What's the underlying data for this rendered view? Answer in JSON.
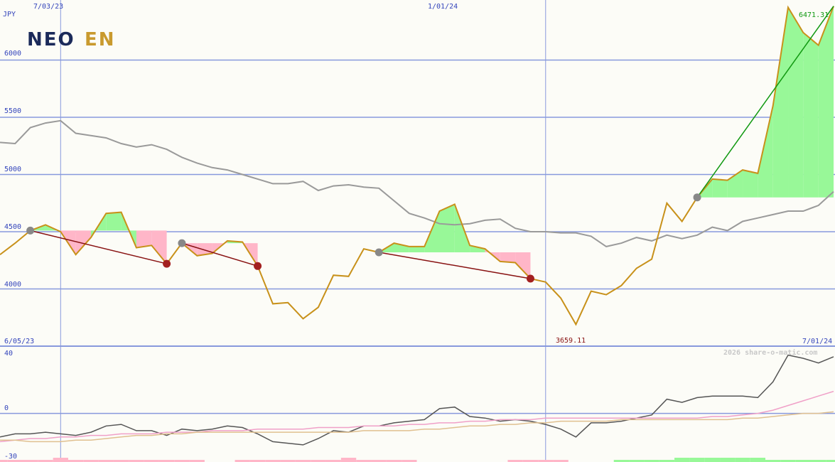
{
  "chart_data": [
    {
      "type": "line",
      "currency": "JPY",
      "logo": {
        "part_a": "NEO",
        "part_b": "EN"
      },
      "y_ticks": [
        "6000",
        "5500",
        "5000",
        "4500",
        "4000"
      ],
      "ylim": [
        3500,
        6500
      ],
      "date_labels": [
        "7/03/23",
        "1/01/24"
      ],
      "start_label": "6/05/23",
      "end_label": "7/01/24",
      "max_label": "6471.31",
      "min_label": "3659.11",
      "credit": "2026 share-o-matic.com",
      "colors": {
        "price": "#c8911a",
        "ma": "#999999",
        "gain": "#98f898",
        "loss": "#ffb6c8",
        "up_trend": "#119911",
        "down_trend": "#881111",
        "grid": "#8899dd"
      },
      "series": [
        {
          "values": [
            4300,
            4400,
            4510,
            4560,
            4500,
            4300,
            4450,
            4660,
            4670,
            4360,
            4380,
            4220,
            4400,
            4290,
            4310,
            4420,
            4410,
            4200,
            3870,
            3880,
            3740,
            3840,
            4120,
            4110,
            4350,
            4320,
            4400,
            4370,
            4370,
            4680,
            4740,
            4380,
            4350,
            4240,
            4230,
            4090,
            4060,
            3920,
            3690,
            3980,
            3950,
            4030,
            4180,
            4260,
            4750,
            4590,
            4800,
            4960,
            4950,
            5040,
            5010,
            5600,
            6460,
            6240,
            6130,
            6471
          ]
        },
        {
          "values": [
            5280,
            5270,
            5410,
            5450,
            5470,
            5360,
            5340,
            5320,
            5270,
            5240,
            5260,
            5220,
            5150,
            5100,
            5060,
            5040,
            5000,
            4960,
            4920,
            4920,
            4940,
            4860,
            4900,
            4910,
            4890,
            4880,
            4770,
            4660,
            4620,
            4570,
            4560,
            4570,
            4600,
            4610,
            4530,
            4500,
            4500,
            4490,
            4490,
            4460,
            4370,
            4400,
            4450,
            4420,
            4470,
            4440,
            4470,
            4540,
            4510,
            4590,
            4620,
            4650,
            4680,
            4680,
            4730,
            4850
          ]
        }
      ],
      "signals": [
        {
          "from": 2,
          "to": 11,
          "kind": "down"
        },
        {
          "from": 12,
          "to": 17,
          "kind": "down"
        },
        {
          "from": 25,
          "to": 35,
          "kind": "down"
        },
        {
          "from": 46,
          "to": 55,
          "kind": "up"
        }
      ],
      "indicator": {
        "y_ticks": [
          "40",
          "0",
          "-30"
        ],
        "ylim": [
          -30,
          40
        ],
        "series": [
          {
            "values": [
              -15,
              -13,
              -13,
              -12,
              -13,
              -14,
              -12,
              -8,
              -7,
              -11,
              -11,
              -14,
              -10,
              -11,
              -10,
              -8,
              -9,
              -13,
              -18,
              -19,
              -20,
              -16,
              -11,
              -12,
              -8,
              -8,
              -6,
              -5,
              -4,
              3,
              4,
              -2,
              -3,
              -5,
              -4,
              -5,
              -7,
              -10,
              -15,
              -6,
              -6,
              -5,
              -3,
              -1,
              9,
              7,
              10,
              11,
              11,
              11,
              10,
              20,
              37,
              35,
              32,
              36
            ]
          },
          {
            "values": [
              -18,
              -17,
              -16,
              -16,
              -15,
              -15,
              -14,
              -14,
              -13,
              -13,
              -13,
              -12,
              -12,
              -12,
              -11,
              -11,
              -11,
              -10,
              -10,
              -10,
              -10,
              -9,
              -9,
              -9,
              -8,
              -8,
              -8,
              -7,
              -7,
              -6,
              -6,
              -5,
              -5,
              -4,
              -4,
              -4,
              -3,
              -3,
              -3,
              -3,
              -3,
              -3,
              -3,
              -3,
              -3,
              -3,
              -3,
              -2,
              -2,
              -1,
              0,
              2,
              5,
              8,
              11,
              14
            ]
          },
          {
            "values": [
              -17,
              -17,
              -18,
              -18,
              -18,
              -17,
              -17,
              -16,
              -15,
              -14,
              -14,
              -13,
              -13,
              -12,
              -12,
              -12,
              -12,
              -12,
              -12,
              -12,
              -12,
              -12,
              -12,
              -12,
              -11,
              -11,
              -11,
              -11,
              -10,
              -10,
              -9,
              -8,
              -8,
              -7,
              -7,
              -6,
              -6,
              -5,
              -5,
              -5,
              -5,
              -4,
              -4,
              -4,
              -4,
              -4,
              -4,
              -4,
              -4,
              -3,
              -3,
              -2,
              -1,
              0,
              0,
              1
            ]
          }
        ],
        "bars": [
          -1,
          -1,
          -1,
          -1,
          -2,
          -1,
          -1,
          -1,
          -1,
          -1,
          -1,
          -1,
          -1,
          -1,
          0,
          0,
          -1,
          -1,
          -1,
          -1,
          -1,
          -1,
          -1,
          -2,
          -1,
          -1,
          -1,
          -1,
          0,
          0,
          0,
          0,
          0,
          0,
          -1,
          -1,
          -1,
          -1,
          0,
          0,
          0,
          1,
          1,
          1,
          1,
          2,
          2,
          2,
          2,
          2,
          2,
          1,
          1,
          1,
          1,
          1
        ]
      }
    }
  ]
}
